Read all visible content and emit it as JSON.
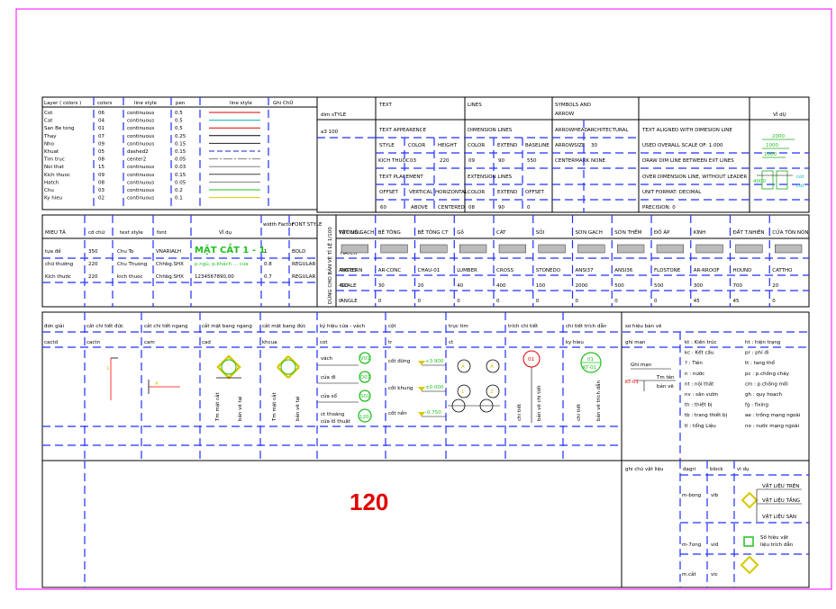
{
  "colors": {
    "frame": "#ff00ff",
    "layer_cot": "#e00000",
    "layer_cat": "#00b8b8",
    "layer_san": "#e00000",
    "layer_thay": "#000000",
    "layer_nho": "#202020",
    "layer_khuat": "#2020c0",
    "layer_timtruc": "#808080",
    "layer_noithat": "#808080",
    "layer_kichthuoc": "#404040",
    "layer_hatch": "#808080",
    "layer_chu": "#22c022",
    "layer_kyhieu": "#d8c800",
    "dash_lines": "#2030ff",
    "big_number": "#e00000",
    "symbol_green": "#22c022"
  },
  "layers": {
    "headers": [
      "Layer ( colors )",
      "colors",
      "line style",
      "pen",
      "line style",
      "Ghi ChÚ"
    ],
    "rows": [
      {
        "name": "Cot",
        "color": "06",
        "style": "continuous",
        "pen": "0.5"
      },
      {
        "name": "Cat",
        "color": "04",
        "style": "continuous",
        "pen": "0.5"
      },
      {
        "name": "San Be tong",
        "color": "01",
        "style": "continuous",
        "pen": "0.5"
      },
      {
        "name": "Thay",
        "color": "07",
        "style": "continuous",
        "pen": "0.25"
      },
      {
        "name": "Nho",
        "color": "09",
        "style": "continuous",
        "pen": "0.15"
      },
      {
        "name": "Khuat",
        "color": "05",
        "style": "dashed2",
        "pen": "0.15"
      },
      {
        "name": "Tim truc",
        "color": "08",
        "style": "center2",
        "pen": "0.05"
      },
      {
        "name": "Noi that",
        "color": "15",
        "style": "continuous",
        "pen": "0.03"
      },
      {
        "name": "Kich thuoc",
        "color": "09",
        "style": "continuous",
        "pen": "0.15"
      },
      {
        "name": "Hatch",
        "color": "08",
        "style": "continuous",
        "pen": "0.05"
      },
      {
        "name": "Chu",
        "color": "03",
        "style": "continuous",
        "pen": "0.2"
      },
      {
        "name": "Ky hieu",
        "color": "02",
        "style": "continuous",
        "pen": "0.1"
      }
    ]
  },
  "dimstyle": {
    "dim_style_label": "dim sTYLE",
    "a3_label": "a3 100",
    "text": "TEXT",
    "text_appearance": "TEXT APPEARENCE",
    "style": "STYLE",
    "color": "COLOR",
    "height": "HEIGHT",
    "kich_thuoc": "KICH THUOC",
    "kich_thuoc_val": "03",
    "height_val": "220",
    "text_placement": "TEXT PLACEMENT",
    "offset": "OFFSET",
    "vertical": "VERTICAL",
    "horizontal": "HORIZONTAL",
    "offset_val": "60",
    "above": "ABOVE",
    "centered": "CENTERED",
    "lines": "LINES",
    "dimension_lines": "DIMENSION LINES",
    "extend": "EXTEND",
    "baseline": "BASELINE",
    "dim_color_val": "09",
    "dim_extend_val": "90",
    "baseline_val": "550",
    "extension_lines": "EXTENSION LINES",
    "ext_offset": "OFFSET",
    "ext_color_val": "08",
    "ext_extend_val": "90",
    "ext_offset_val": "0",
    "symbols": "SYMBOLS AND",
    "arrow": "ARROW",
    "arrowhead": "ARROWHEAD",
    "architectural": "ARCHITECTURAL",
    "arrowsize": "ARROWSIZE",
    "arrowsize_val": "30",
    "centermark": "CENTERMARK",
    "centermark_val": "NONE",
    "aligned": "TEXT ALIGNED WITH DIMESION LINE",
    "overall_scale": "USED OVERALL SCALE OF: 1.000",
    "draw_dim": "DRAW DIM LINE BETWEEN EXT LINES",
    "over_dim": "OVER DIMENSION LINE, WITHOUT LEADER",
    "unit_format": "UNIT FORMAT: DECIMAL",
    "precision": "PRECISION: 0",
    "vi_du": "VÍ dỤ",
    "vi_du_labels": [
      "2000",
      "1000",
      "1000",
      "4000",
      "cot",
      "cot"
    ]
  },
  "text_styles": {
    "headers": [
      "MIEU TẢ",
      "cỡ chữ",
      "text style",
      "font",
      "VÍ dụ",
      "width Factor",
      "FONT STYLE"
    ],
    "rows": [
      {
        "desc": "tựa đề",
        "size": "350",
        "style": "Chu To",
        "font": "VNARIALH",
        "example": "MẶT CẮT 1 - 1",
        "factor": "1",
        "fstyle": "BOLD"
      },
      {
        "desc": "chữ thường",
        "size": "220",
        "style": "Chu Thuong",
        "font": "Chhbg.SHX",
        "example": "p.ngủ, p.khách ... cửa",
        "factor": "0.8",
        "fstyle": "REGULAR"
      },
      {
        "desc": "Kích thước",
        "size": "220",
        "style": "kich thuoc",
        "font": "Chhbg.SHX",
        "example": "1234567890,00",
        "factor": "0.7",
        "fstyle": "REGULAR"
      }
    ]
  },
  "hatch_table": {
    "side_label": "DÙNG CHO BẢN VẼ TỈ LỆ 1/100",
    "row_labels": [
      "VẬT LIỆU",
      "HATCH",
      "PATTERN",
      "SCALE",
      "ANGLE"
    ],
    "columns": [
      {
        "name": "TƯỜNG GẠCH",
        "pattern": "ANSI31",
        "scale": "400",
        "angle": "0"
      },
      {
        "name": "BÊ TÔNG",
        "pattern": "AR-CONC",
        "scale": "30",
        "angle": "0"
      },
      {
        "name": "BÊ TÔNG CT",
        "pattern": "CHAU-01",
        "scale": "20",
        "angle": "0"
      },
      {
        "name": "Gỗ",
        "pattern": "LUMBER",
        "scale": "40",
        "angle": "0"
      },
      {
        "name": "CÁT",
        "pattern": "CROSS",
        "scale": "400",
        "angle": "0"
      },
      {
        "name": "SỎI",
        "pattern": "STONEDO",
        "scale": "100",
        "angle": "0"
      },
      {
        "name": "SƠN GẠCH",
        "pattern": "ANSI37",
        "scale": "2000",
        "angle": "0"
      },
      {
        "name": "SƠN THỂM",
        "pattern": "ANSI36",
        "scale": "500",
        "angle": "0"
      },
      {
        "name": "ĐỐ ÁP",
        "pattern": "FLDSTONE",
        "scale": "500",
        "angle": "0"
      },
      {
        "name": "KÍNH",
        "pattern": "AR-RROOF",
        "scale": "300",
        "angle": "45"
      },
      {
        "name": "ĐẤT T.NHIÊN",
        "pattern": "HOUND",
        "scale": "700",
        "angle": "45"
      },
      {
        "name": "CỬA TÔN NÒN",
        "pattern": "CATTHO",
        "scale": "20",
        "angle": "0"
      }
    ]
  },
  "symbols": {
    "headers": [
      "đơn giải",
      "cắt chi tiết đức",
      "cắt chi tiết ngang",
      "cắt mặt bang ngang",
      "cắt mặt bang đức",
      "ký hiệu cửa - vách",
      "cột",
      "trục tim",
      "trích chi tiết",
      "chi tiết trích dẫn",
      "sơ hiệu bản vẽ"
    ],
    "subs": [
      "cactd",
      "cactn",
      "cam",
      "cad",
      "khcua",
      "cot",
      "tr",
      "ct",
      "",
      "ky hieu",
      "ghi man"
    ],
    "labels": {
      "tm_mat_cat": "Tm mặt cắt",
      "ve_tai": "bản vẽ tại",
      "vach": "vách",
      "cua_di": "cửa đi",
      "cua_so": "cửa sổ",
      "ct_thong": "ct thoáng",
      "lo_thuat": "cửa lồ thuật",
      "cot_dung": "cốt đứng",
      "cot_khung": "cốt khung",
      "cot_nen": "cốt nền",
      "lv1": "+3.900",
      "lv2": "±0.000",
      "lv3": "-0.750",
      "cua_tags": [
        "V01",
        "D01",
        "S01",
        "120"
      ],
      "axis_a": "A",
      "axis_1": "1",
      "axis_2": "2",
      "chi_tiet": "chi tiết",
      "ban_ve": "bản vẽ chi tiết",
      "bv_trich": "bản vẽ trích dẫn",
      "bv_label": "01",
      "kt_label": "KT-01",
      "tm_ten": "Tm tên",
      "ban_ve_so": "bản vẽ",
      "ghi_man": "Ghi mạn"
    },
    "abbrev": [
      [
        "kt : Kiến trúc",
        "ht : hiện trạng"
      ],
      [
        "kc : Kết cấu",
        "pr : phí đi"
      ],
      [
        "? : Tiên",
        "tt : tang thổ"
      ],
      [
        "n : nước",
        "pc : p.chống cháy"
      ],
      [
        "nt : nội thất",
        "cm : p.chống mối"
      ],
      [
        "nv : sân vườn",
        "gh : quy hoạch"
      ],
      [
        "th : thiết bị",
        "fg : fixing"
      ],
      [
        "tb : trang thiết bị",
        "ae : trống mạng ngoài"
      ],
      [
        "tl : tổng Liệu",
        "no : nước mạng ngoài"
      ]
    ]
  },
  "notes": {
    "big_number": "120",
    "ghi_chu_label": "ghi chú vật liệu",
    "dau_gach": "dạgri",
    "block": "block",
    "vi_du": "vĩ dụ",
    "rows": [
      {
        "code": "m-bong",
        "block": "vib"
      },
      {
        "code": "m-7ong",
        "block": "vid"
      },
      {
        "code": "m.cắt",
        "block": "vic"
      }
    ],
    "vat_lieu": [
      "VẬT LIỆU TRÊN",
      "VẬT LIỆU TẦNG",
      "VẬT LIỆU SÀN"
    ],
    "so_hieu": "Số hiệu vật",
    "lieu_trich": "liệu trích dẫn"
  }
}
